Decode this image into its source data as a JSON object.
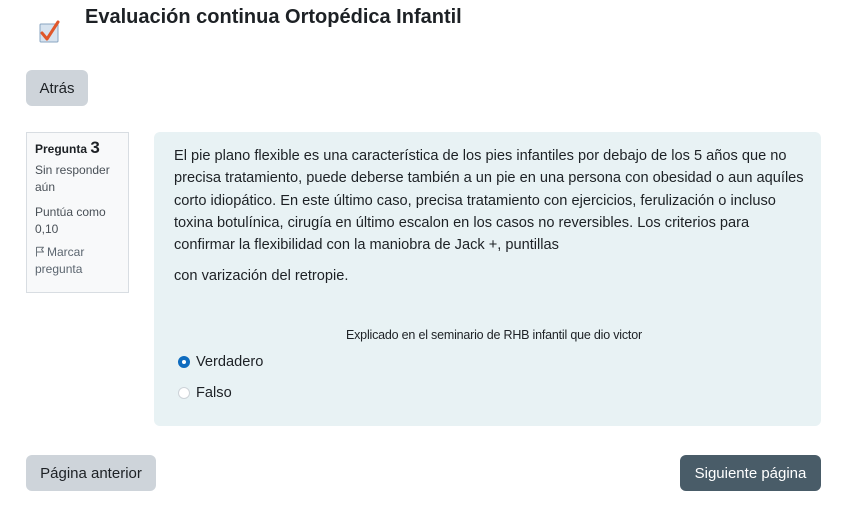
{
  "header": {
    "title": "Evaluación continua Ortopédica Infantil",
    "icon": "quiz-icon"
  },
  "nav": {
    "back_label": "Atrás",
    "prev_label": "Página anterior",
    "next_label": "Siguiente página"
  },
  "question_info": {
    "label": "Pregunta",
    "number": "3",
    "state": "Sin responder aún",
    "grade": "Puntúa como 0,10",
    "flag_label": "Marcar pregunta"
  },
  "question": {
    "text": "El pie plano flexible es una característica de los pies infantiles por debajo de los 5 años que no precisa tratamiento, puede deberse también a un pie en una persona con obesidad o aun aquíles corto idiopático. En este último caso, precisa tratamiento con ejercicios, ferulización o incluso toxina botulínica, cirugía en último escalon en los casos no reversibles. Los criterios para confirmar la flexibilidad con la maniobra de Jack +, puntillas",
    "text_tail": "con varización del retropie.",
    "note": "Explicado en el seminario de RHB infantil que dio victor",
    "options": [
      {
        "label": "Verdadero",
        "selected": true
      },
      {
        "label": "Falso",
        "selected": false
      }
    ]
  },
  "colors": {
    "primary": "#0f6cbf",
    "content_bg": "#e8f2f4",
    "next_button": "#495c68",
    "secondary_button": "#ced4da"
  }
}
